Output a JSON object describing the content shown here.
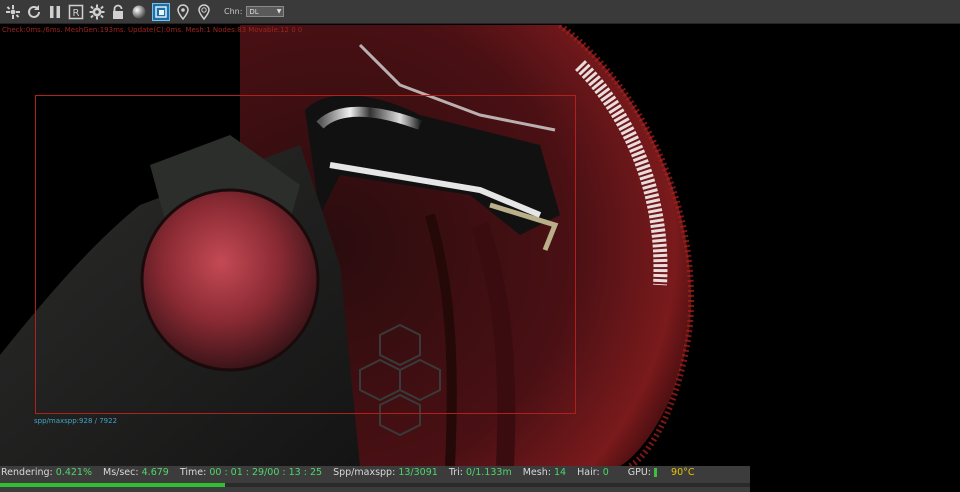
{
  "toolbar": {
    "icons": [
      "clear-icon",
      "restart-icon",
      "pause-icon",
      "rectangle-icon",
      "settings-icon",
      "lock-icon",
      "material-preview-icon",
      "region-render-icon",
      "pick-focus-icon",
      "pick-material-icon"
    ],
    "channel_label": "Chn:",
    "channel_value": "DL"
  },
  "overlay": {
    "stats": "Check:0ms./6ms. MeshGen:193ms. Update(C):0ms. Mesh:1 Nodes:83 Movable:12 0 0",
    "spp": "spp/maxspp:928 / 7922"
  },
  "statusbar": {
    "rendering_label": "Rendering:",
    "rendering_value": "0.421%",
    "ms_label": "Ms/sec:",
    "ms_value": "4.679",
    "time_label": "Time:",
    "time_value": "00 : 01 : 29/00 : 13 : 25",
    "spp_label": "Spp/maxspp:",
    "spp_value": "13/3091",
    "tri_label": "Tri:",
    "tri_value": "0/1.133m",
    "mesh_label": "Mesh:",
    "mesh_value": "14",
    "hair_label": "Hair:",
    "hair_value": "0",
    "gpu_label": "GPU:",
    "gpu_temp": "90°C",
    "progress_fraction": 0.3
  }
}
